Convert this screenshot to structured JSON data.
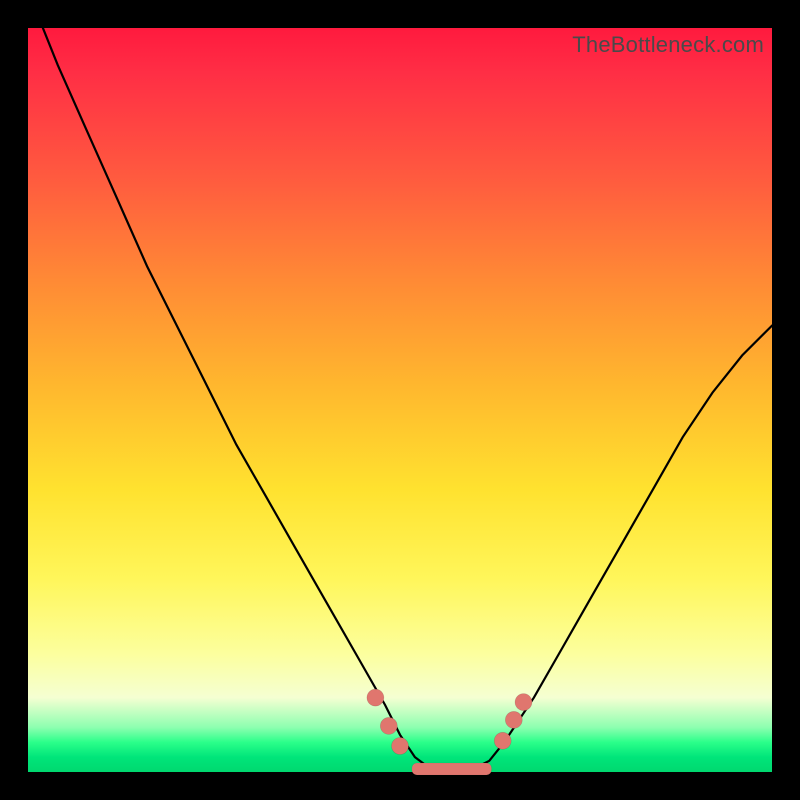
{
  "attribution": "TheBottleneck.com",
  "colors": {
    "frame": "#000000",
    "curve": "#000000",
    "marker": "#e0766e",
    "gradient_stops": [
      "#ff1a3e",
      "#ff5a3f",
      "#ffb72e",
      "#fff65a",
      "#f5ffd2",
      "#00d86f"
    ]
  },
  "chart_data": {
    "type": "line",
    "title": "",
    "xlabel": "",
    "ylabel": "",
    "xlim": [
      0,
      100
    ],
    "ylim": [
      0,
      100
    ],
    "grid": false,
    "legend": false,
    "series": [
      {
        "name": "bottleneck-curve",
        "x": [
          0,
          4,
          8,
          12,
          16,
          20,
          24,
          28,
          32,
          36,
          40,
          44,
          48,
          50,
          52,
          54,
          56,
          58,
          60,
          62,
          64,
          68,
          72,
          76,
          80,
          84,
          88,
          92,
          96,
          100
        ],
        "y": [
          105,
          95,
          86,
          77,
          68,
          60,
          52,
          44,
          37,
          30,
          23,
          16,
          9,
          5,
          2,
          0.5,
          0.3,
          0.3,
          0.5,
          1.5,
          4,
          10,
          17,
          24,
          31,
          38,
          45,
          51,
          56,
          60
        ]
      }
    ],
    "markers": {
      "name": "fit-points",
      "points": [
        {
          "x": 46.7,
          "y": 10.0
        },
        {
          "x": 48.5,
          "y": 6.2
        },
        {
          "x": 50.0,
          "y": 3.5
        },
        {
          "x": 63.8,
          "y": 4.2
        },
        {
          "x": 65.3,
          "y": 7.0
        },
        {
          "x": 66.6,
          "y": 9.4
        }
      ]
    },
    "valley_bar": {
      "x0": 51.6,
      "x1": 62.3,
      "y": 0.4
    },
    "annotations": []
  }
}
